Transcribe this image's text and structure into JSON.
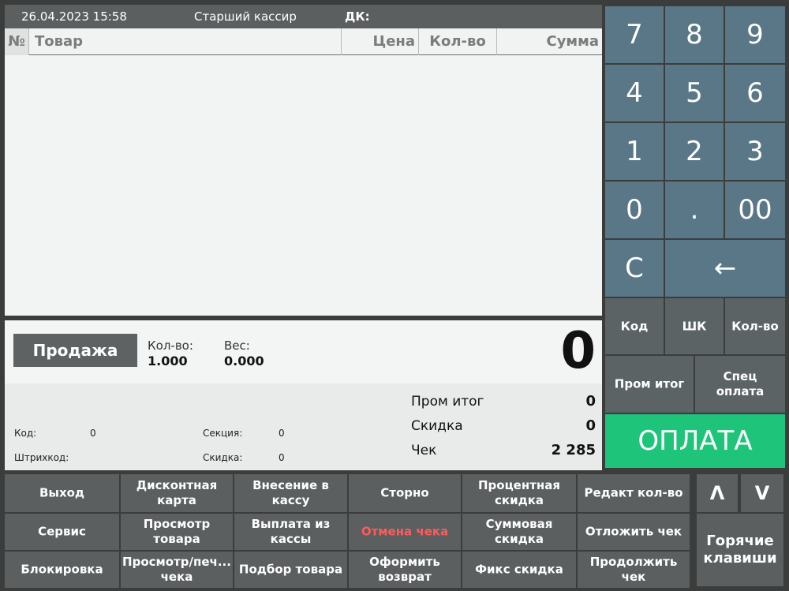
{
  "header": {
    "datetime": "26.04.2023 15:58",
    "user": "Старший кассир",
    "dk_label": "ДК:"
  },
  "table": {
    "col_num": "№",
    "col_item": "Товар",
    "col_price": "Цена",
    "col_qty": "Кол-во",
    "col_sum": "Сумма"
  },
  "info": {
    "sale_button": "Продажа",
    "qty_label": "Кол-во:",
    "qty_value": "1.000",
    "weight_label": "Вес:",
    "weight_value": "0.000",
    "big_total": "0",
    "code_label": "Код:",
    "code_value": "0",
    "barcode_label": "Штрихкод:",
    "section_label": "Секция:",
    "section_value": "0",
    "discount_label": "Скидка:",
    "discount_value": "0",
    "subtotal_label": "Пром итог",
    "subtotal_value": "0",
    "discount_total_label": "Скидка",
    "discount_total_value": "0",
    "check_label": "Чек",
    "check_value": "2 285"
  },
  "keypad": {
    "k7": "7",
    "k8": "8",
    "k9": "9",
    "k4": "4",
    "k5": "5",
    "k6": "6",
    "k1": "1",
    "k2": "2",
    "k3": "3",
    "k0": "0",
    "kdot": ".",
    "k00": "00",
    "kc": "C",
    "kback": "←",
    "code": "Код",
    "barcode": "ШК",
    "qty": "Кол-во",
    "subtotal": "Пром итог",
    "special_payment": "Спец оплата",
    "pay": "ОПЛАТА"
  },
  "bottom": {
    "exit": "Выход",
    "discount_card": "Дисконтная карта",
    "cash_in": "Внесение в кассу",
    "storno": "Сторно",
    "percent_discount": "Процентная скидка",
    "edit_qty": "Редакт кол-во",
    "service": "Сервис",
    "view_item": "Просмотр товара",
    "cash_out": "Выплата из кассы",
    "cancel_check": "Отмена чека",
    "sum_discount": "Суммовая скидка",
    "defer_check": "Отложить чек",
    "lock": "Блокировка",
    "view_print_check": "Просмотр/печ... чека",
    "item_selection": "Подбор товара",
    "make_return": "Оформить возврат",
    "fixed_discount": "Фикс скидка",
    "continue_check": "Продолжить чек",
    "up": "Λ",
    "down": "V",
    "hotkeys": "Горячие клавиши"
  },
  "colors": {
    "pay_green": "#1fc47b",
    "keypad_blue": "#5a7787",
    "cancel_red": "#ff5b5b"
  }
}
